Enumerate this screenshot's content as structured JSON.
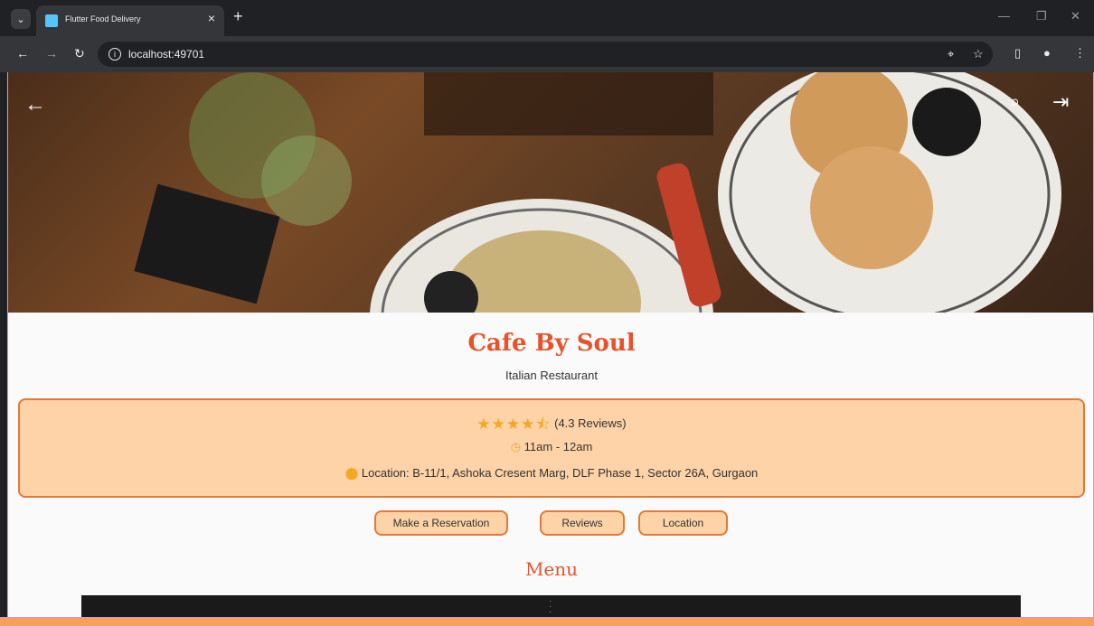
{
  "browser": {
    "tab_title": "Flutter Food Delivery",
    "url": "localhost:49701"
  },
  "restaurant": {
    "name": "Cafe By Soul",
    "type": "Italian Restaurant",
    "rating_text": "(4.3 Reviews)",
    "rating_value": 4.3,
    "hours": "11am - 12am",
    "location": "Location: B-11/1, Ashoka Cresent Marg, DLF Phase 1, Sector 26A, Gurgaon"
  },
  "actions": {
    "reservation": "Make a Reservation",
    "reviews": "Reviews",
    "location": "Location"
  },
  "menu": {
    "title": "Menu"
  },
  "colors": {
    "accent": "#e8522a",
    "card_bg": "#fdd3a7",
    "card_border": "#e07a3a",
    "star": "#f5a623"
  }
}
